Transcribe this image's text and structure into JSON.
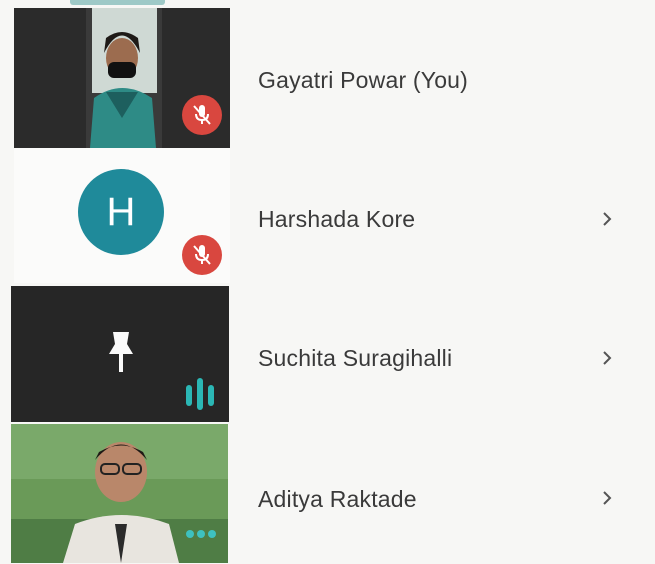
{
  "participants": [
    {
      "name": "Gayatri Powar (You)",
      "status": "muted",
      "tile": "video",
      "has_chevron": false
    },
    {
      "name": "Harshada Kore",
      "status": "muted",
      "tile": "avatar",
      "avatar_letter": "H",
      "has_chevron": true
    },
    {
      "name": "Suchita Suragihalli",
      "status": "speaking",
      "tile": "pinned",
      "has_chevron": true
    },
    {
      "name": "Aditya Raktade",
      "status": "more",
      "tile": "video",
      "has_chevron": true
    }
  ],
  "colors": {
    "accent_teal": "#1f8f96",
    "mute_red": "#d9473f",
    "avatar_teal": "#1f8a9a",
    "dark_tile": "#2a2a2a"
  },
  "icons": {
    "mute": "mic-off-icon",
    "chevron": "chevron-right-icon",
    "pin": "pin-icon",
    "speaking": "audio-level-icon",
    "more": "more-dots-icon"
  }
}
